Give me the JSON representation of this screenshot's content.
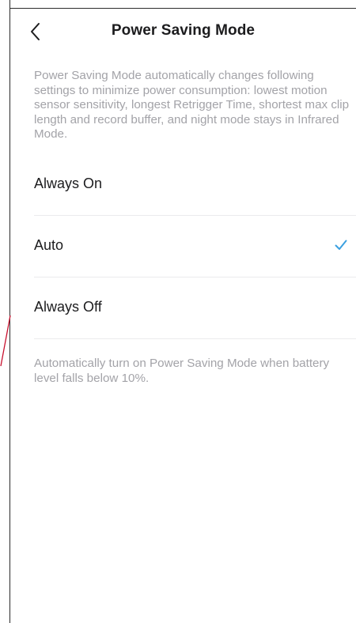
{
  "header": {
    "title": "Power Saving Mode",
    "back_icon": "chevron-left-icon"
  },
  "description": "Power Saving Mode automatically changes following settings to minimize power consumption: lowest motion sensor sensitivity, longest Retrigger Time, shortest max clip length and record buffer, and night mode stays in Infrared Mode.",
  "options": [
    {
      "label": "Always On",
      "selected": false
    },
    {
      "label": "Auto",
      "selected": true
    },
    {
      "label": "Always Off",
      "selected": false
    }
  ],
  "footer_note": "Automatically turn on Power Saving Mode when battery level falls below 10%.",
  "colors": {
    "accent": "#3aa0e0",
    "secondary_text": "#a3a3a8",
    "primary_text": "#1c1c1e",
    "divider": "#ebebed"
  },
  "icons": {
    "selected_check": "checkmark-icon"
  }
}
